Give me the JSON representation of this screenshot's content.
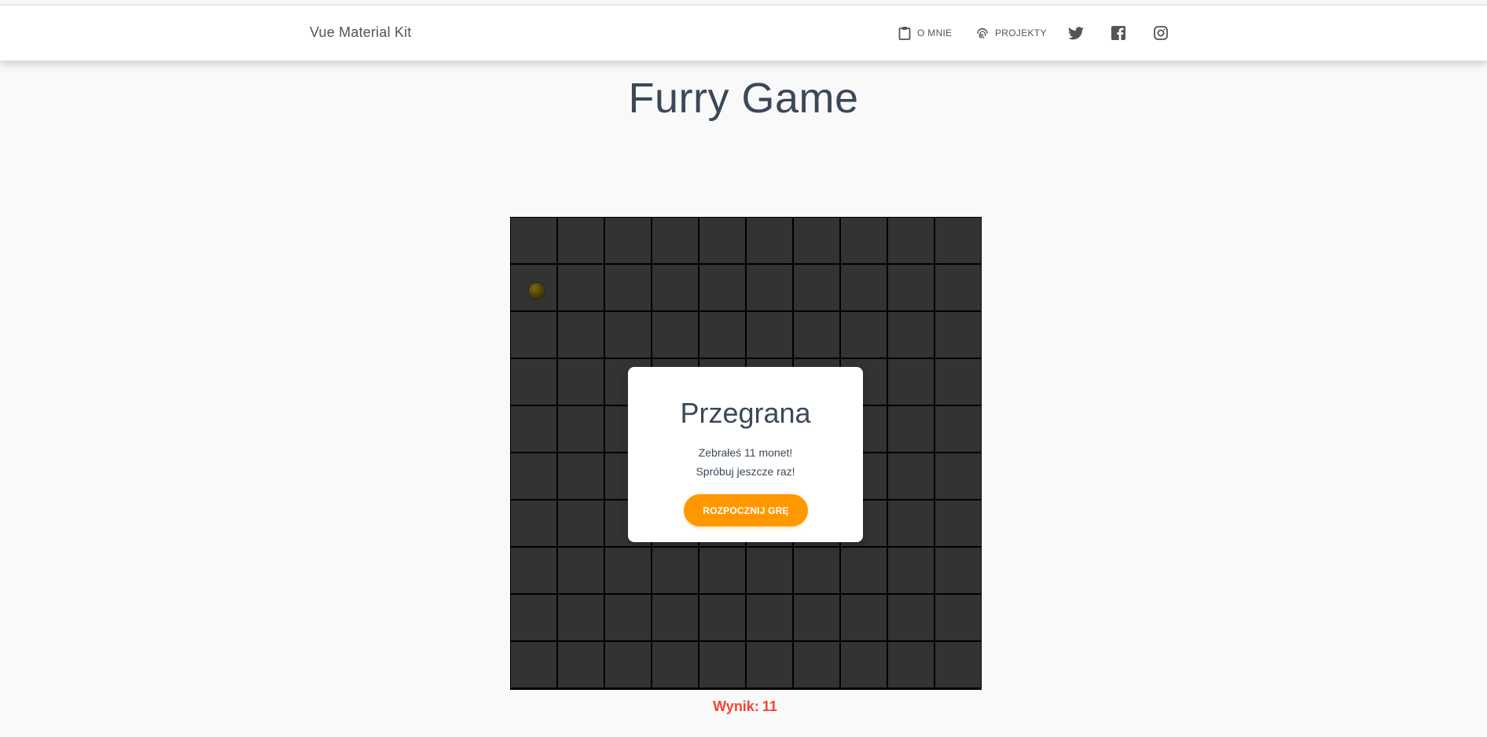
{
  "navbar": {
    "brand": "Vue Material Kit",
    "items": [
      {
        "label": "O mnie",
        "icon": "clipboard-icon"
      },
      {
        "label": "Projekty",
        "icon": "fingerprint-icon"
      }
    ],
    "social": [
      "twitter-icon",
      "facebook-icon",
      "instagram-icon"
    ]
  },
  "page": {
    "title": "Furry Game"
  },
  "board": {
    "rows": 10,
    "cols": 10,
    "cell_color": "#333333",
    "grid_color": "#000000",
    "coin": {
      "row": 2,
      "col": 1,
      "icon": "coin-icon"
    }
  },
  "modal": {
    "title": "Przegrana",
    "line1": "Zebrałeś 11 monet!",
    "line2": "Spróbuj jeszcze raz!",
    "button": "ROZPOCZNIJ GRĘ",
    "button_color": "#ff9800"
  },
  "score": {
    "label": "Wynik:",
    "value": "11",
    "color": "#f44336"
  }
}
